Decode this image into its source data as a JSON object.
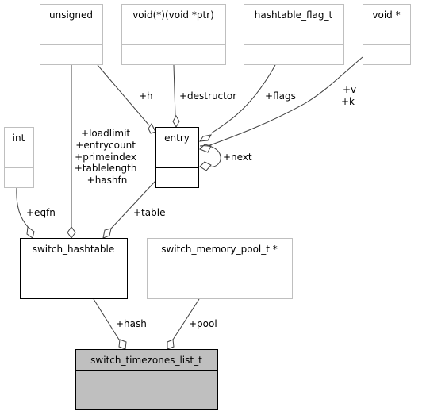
{
  "nodes": {
    "unsigned": {
      "name": "unsigned",
      "style": "external"
    },
    "destructor_type": {
      "name": "void(*)(void *ptr)",
      "style": "external"
    },
    "flag_type": {
      "name": "hashtable_flag_t",
      "style": "external"
    },
    "void_ptr": {
      "name": "void *",
      "style": "external"
    },
    "int": {
      "name": "int",
      "style": "external"
    },
    "entry": {
      "name": "entry",
      "style": "normal"
    },
    "switch_hashtable": {
      "name": "switch_hashtable",
      "style": "normal"
    },
    "memory_pool": {
      "name": "switch_memory_pool_t *",
      "style": "external"
    },
    "timezones_list": {
      "name": "switch_timezones_list_t",
      "style": "focus"
    }
  },
  "edges": {
    "h": "+h",
    "destructor": "+destructor",
    "flags": "+flags",
    "v": "+v",
    "k": "+k",
    "next": "+next",
    "eqfn": "+eqfn",
    "unsigned_members": [
      "+loadlimit",
      "+entrycount",
      "+primeindex",
      "+tablelength",
      "+hashfn"
    ],
    "table": "+table",
    "hash": "+hash",
    "pool": "+pool"
  },
  "colors": {
    "focus_fill": "#bfbfbf",
    "normal_border": "#000000",
    "external_border": "#bfbfbf",
    "edge": "#404040"
  }
}
